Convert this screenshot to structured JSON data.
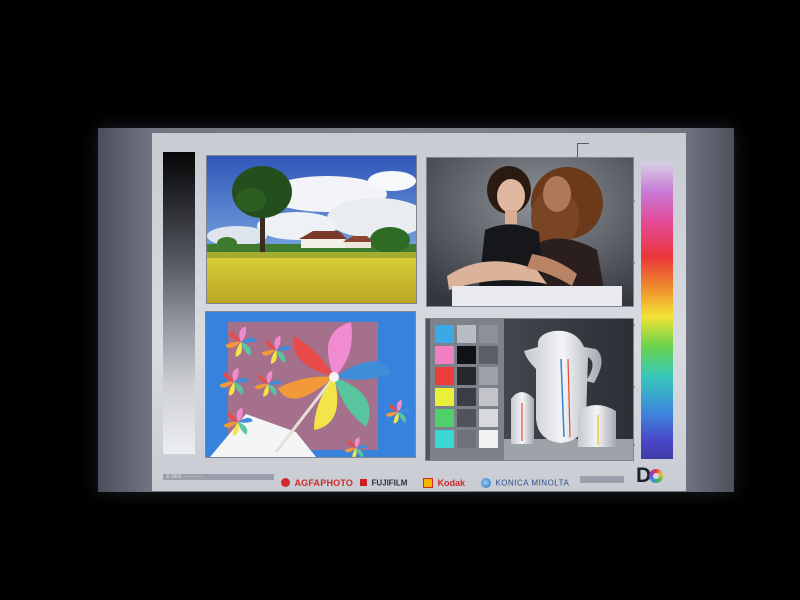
{
  "panel": {
    "top_line": "· · · · · · · · · · · · · · · · · · · · · · · · · · · · · · · · · · · · · · · · · · · · · · · · · · · · · · · · ·",
    "nav": [
      "",
      "",
      "",
      ""
    ],
    "brand_note": "",
    "brand_logo": {
      "line1": "",
      "line2": ""
    }
  },
  "photos": {
    "landscape": {
      "icon": "tree-field-house-icon"
    },
    "portrait": {
      "icon": "two-women-portrait-icon"
    },
    "pinwheel": {
      "icon": "pinwheel-icon"
    },
    "color_chart": {
      "icon": "color-checker-icon",
      "swatch_colors": [
        [
          "#3ba9e6",
          "#b9bcc3",
          "#8d9098"
        ],
        [
          "#f27fc1",
          "#111216",
          "#5b5e66"
        ],
        [
          "#ec3c3c",
          "#26282e",
          "#9ea1a8"
        ],
        [
          "#eaf03a",
          "#3a3d43",
          "#c3c5ca"
        ],
        [
          "#4fd06a",
          "#50535a",
          "#d7d9dd"
        ],
        [
          "#39d8d2",
          "#6e7179",
          "#f1f2f4"
        ]
      ]
    }
  },
  "footer": {
    "copyright": "© 2005 ················",
    "logos": [
      {
        "mark": "agfa-mark-icon",
        "name": "AGFAPHOTO"
      },
      {
        "mark": "fujifilm-mark-icon",
        "name": "FUJIFILM"
      },
      {
        "mark": "kodak-mark-icon",
        "name": "Kodak"
      },
      {
        "mark": "konica-mark-icon",
        "name": "KONICA MINOLTA"
      }
    ],
    "button_label": "",
    "dq_logo": "D"
  }
}
